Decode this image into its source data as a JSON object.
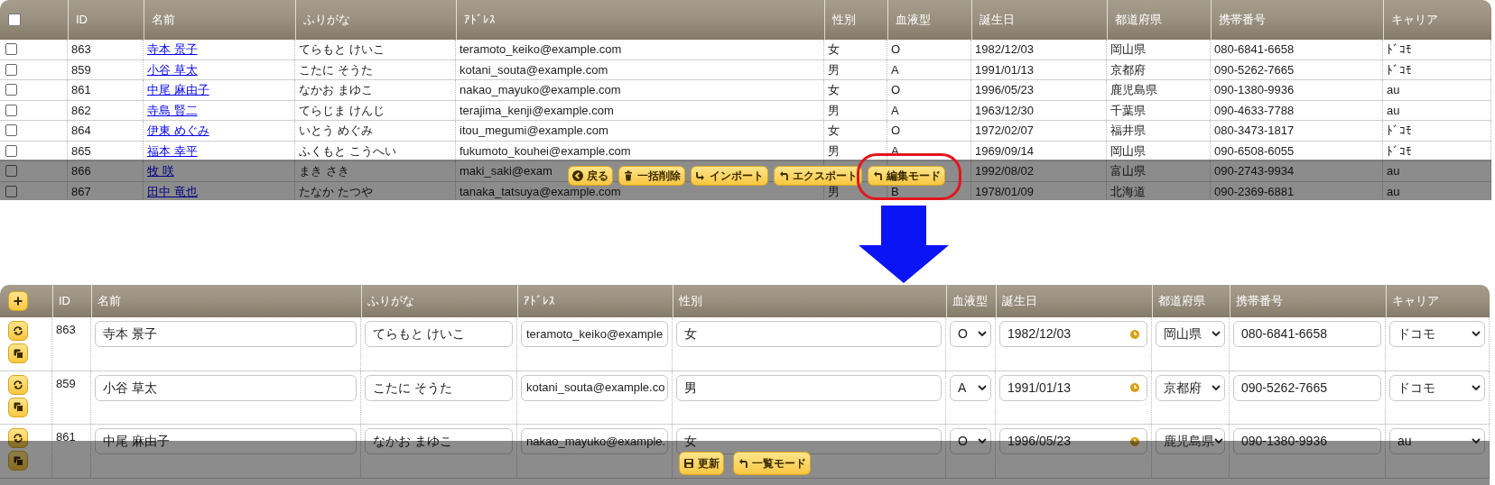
{
  "list_view": {
    "header_checkbox": {
      "checked": false
    },
    "columns": [
      "ID",
      "名前",
      "ふりがな",
      "ｱﾄﾞﾚｽ",
      "性別",
      "血液型",
      "誕生日",
      "都道府県",
      "携帯番号",
      "キャリア"
    ],
    "rows": [
      {
        "checked": false,
        "id": "863",
        "name": "寺本 景子",
        "kana": "てらもと けいこ",
        "email": "teramoto_keiko@example.com",
        "gender": "女",
        "blood": "O",
        "birthday": "1982/12/03",
        "prefecture": "岡山県",
        "phone": "080-6841-6658",
        "carrier": "ﾄﾞｺﾓ"
      },
      {
        "checked": false,
        "id": "859",
        "name": "小谷 草太",
        "kana": "こたに そうた",
        "email": "kotani_souta@example.com",
        "gender": "男",
        "blood": "A",
        "birthday": "1991/01/13",
        "prefecture": "京都府",
        "phone": "090-5262-7665",
        "carrier": "ﾄﾞｺﾓ"
      },
      {
        "checked": false,
        "id": "861",
        "name": "中尾 麻由子",
        "kana": "なかお まゆこ",
        "email": "nakao_mayuko@example.com",
        "gender": "女",
        "blood": "O",
        "birthday": "1996/05/23",
        "prefecture": "鹿児島県",
        "phone": "090-1380-9936",
        "carrier": "au"
      },
      {
        "checked": false,
        "id": "862",
        "name": "寺島 賢二",
        "kana": "てらじま けんじ",
        "email": "terajima_kenji@example.com",
        "gender": "男",
        "blood": "A",
        "birthday": "1963/12/30",
        "prefecture": "千葉県",
        "phone": "090-4633-7788",
        "carrier": "au"
      },
      {
        "checked": false,
        "id": "864",
        "name": "伊東 めぐみ",
        "kana": "いとう めぐみ",
        "email": "itou_megumi@example.com",
        "gender": "女",
        "blood": "O",
        "birthday": "1972/02/07",
        "prefecture": "福井県",
        "phone": "080-3473-1817",
        "carrier": "ﾄﾞｺﾓ"
      },
      {
        "checked": false,
        "id": "865",
        "name": "福本 幸平",
        "kana": "ふくもと こうへい",
        "email": "fukumoto_kouhei@example.com",
        "gender": "男",
        "blood": "A",
        "birthday": "1969/09/14",
        "prefecture": "岡山県",
        "phone": "090-6508-6055",
        "carrier": "ﾄﾞｺﾓ"
      },
      {
        "checked": false,
        "id": "866",
        "name": "牧 咲",
        "kana": "まき さき",
        "email": "maki_saki@exam",
        "birthday": "1992/08/02",
        "prefecture": "富山県",
        "phone": "090-2743-9934",
        "carrier": "au"
      },
      {
        "checked": false,
        "id": "867",
        "name": "田中 竜也",
        "kana": "たなか たつや",
        "email": "tanaka_tatsuya@example.com",
        "gender": "男",
        "blood": "B",
        "birthday": "1978/01/09",
        "prefecture": "北海道",
        "phone": "090-2369-6881",
        "carrier": "au"
      }
    ],
    "toolbar": {
      "buttons": [
        {
          "label": "戻る",
          "kind": "back",
          "highlighted": false
        },
        {
          "label": "一括削除",
          "kind": "delete",
          "highlighted": false
        },
        {
          "label": "インポート",
          "kind": "import",
          "highlighted": false
        },
        {
          "label": "エクスポート",
          "kind": "undo",
          "highlighted": false
        },
        {
          "label": "編集モード",
          "kind": "undo",
          "highlighted": true
        }
      ]
    }
  },
  "edit_view": {
    "columns": [
      "ID",
      "名前",
      "ふりがな",
      "ｱﾄﾞﾚｽ",
      "性別",
      "血液型",
      "誕生日",
      "都道府県",
      "携帯番号",
      "キャリア"
    ],
    "rows": [
      {
        "id": "863",
        "name": "寺本 景子",
        "kana": "てらもと けいこ",
        "email": "teramoto_keiko@example",
        "gender": "女",
        "blood": "O",
        "birthday": "1982/12/03",
        "prefecture": "岡山県",
        "phone": "080-6841-6658",
        "carrier": "ドコモ"
      },
      {
        "id": "859",
        "name": "小谷 草太",
        "kana": "こたに そうた",
        "email": "kotani_souta@example.co",
        "gender": "男",
        "blood": "A",
        "birthday": "1991/01/13",
        "prefecture": "京都府",
        "phone": "090-5262-7665",
        "carrier": "ドコモ"
      },
      {
        "id": "861",
        "name": "中尾 麻由子",
        "kana": "なかお まゆこ",
        "email": "nakao_mayuko@example.",
        "gender": "女",
        "blood": "O",
        "birthday": "1996/05/23",
        "prefecture": "鹿児島県",
        "phone": "090-1380-9936",
        "carrier": "au"
      }
    ],
    "toolbar": {
      "buttons": [
        {
          "label": "更新",
          "kind": "save"
        },
        {
          "label": "一覧モード",
          "kind": "undo"
        }
      ]
    }
  }
}
